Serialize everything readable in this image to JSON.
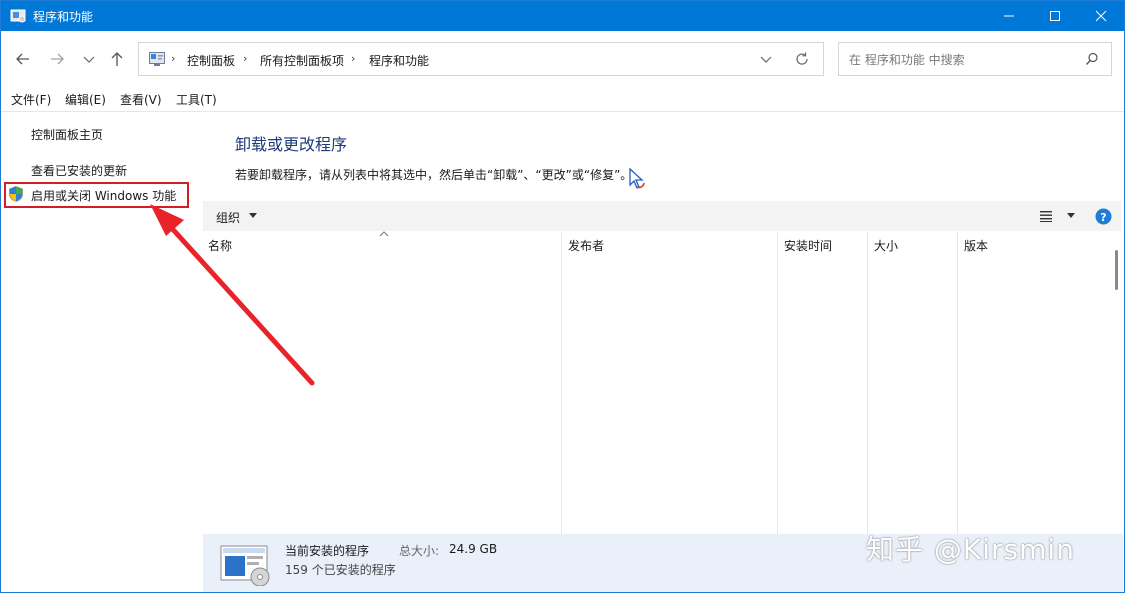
{
  "window": {
    "title": "程序和功能"
  },
  "address": {
    "crumbs": [
      "控制面板",
      "所有控制面板项",
      "程序和功能"
    ]
  },
  "search": {
    "placeholder": "在 程序和功能 中搜索"
  },
  "menu": [
    "文件(F)",
    "编辑(E)",
    "查看(V)",
    "工具(T)"
  ],
  "sidebar": {
    "items": [
      {
        "label": "控制面板主页"
      },
      {
        "label": "查看已安装的更新"
      },
      {
        "label": "启用或关闭 Windows 功能"
      }
    ]
  },
  "main": {
    "heading": "卸载或更改程序",
    "description": "若要卸载程序，请从列表中将其选中，然后单击“卸载”、“更改”或“修复”。",
    "organize_label": "组织",
    "columns": [
      "名称",
      "发布者",
      "安装时间",
      "大小",
      "版本"
    ]
  },
  "details": {
    "title": "当前安装的程序",
    "size_label": "总大小:",
    "size_value": "24.9 GB",
    "count_text": "159 个已安装的程序"
  },
  "watermark": "知乎 @Kirsmin",
  "colors": {
    "titlebar": "#0078d7",
    "highlight": "#d41e25",
    "heading": "#1e3a78"
  }
}
